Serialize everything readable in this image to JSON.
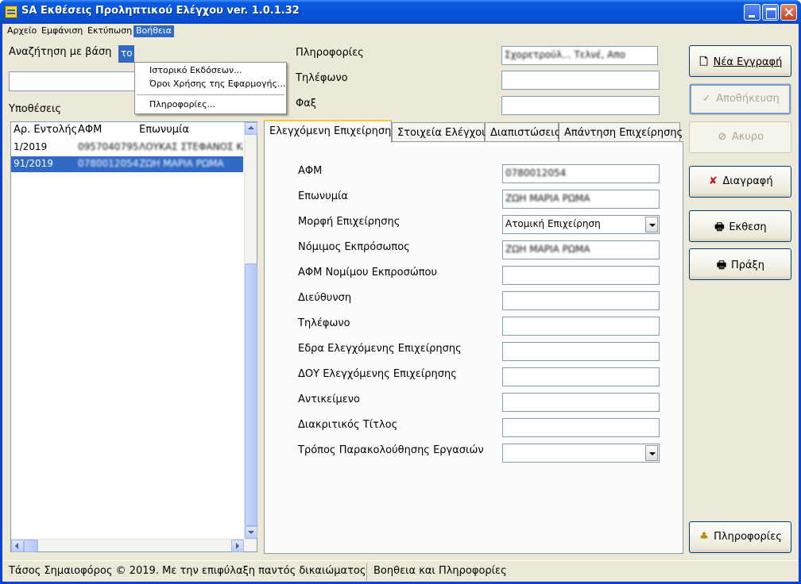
{
  "window": {
    "title": "SA Εκθέσεις Προληπτικού Ελέγχου ver. 1.0.1.32"
  },
  "menubar": {
    "items": [
      "Αρχείο",
      "Εμφάνιση",
      "Εκτύπωση",
      "Βοήθεια"
    ],
    "active": "Βοήθεια"
  },
  "help_menu": {
    "items": [
      "Ιστορικό Εκδόσεων...",
      "Όροι Χρήσης της Εφαρμογής...",
      "Πληροφορίες..."
    ]
  },
  "search": {
    "label": "Αναζήτηση με βάση",
    "combo_value": "το",
    "input_value": ""
  },
  "cases": {
    "label": "Υποθέσεις",
    "columns": [
      "Αρ. Εντολής",
      "ΑΦΜ",
      "Επωνυμία"
    ],
    "rows": [
      {
        "order": "1/2019",
        "afm": "0957040795",
        "name": "ΛΟΥΚΑΣ ΣΤΕΦΑΝΟΣ ΚΑΙ"
      },
      {
        "order": "91/2019",
        "afm": "0780012054",
        "name": "ΖΩΗ ΜΑΡΙΑ ΡΩΜΑ"
      }
    ],
    "selected_index": 1
  },
  "info": {
    "label": "Πληροφορίες",
    "value": "Σχορετρούλ... Τελνέ, Απο",
    "phone_label": "Τηλέφωνο",
    "phone_value": "",
    "fax_label": "Φαξ",
    "fax_value": ""
  },
  "tabs": [
    {
      "label": "Ελεγχόμενη Επιχείρηση",
      "active": true
    },
    {
      "label": "Στοιχεία Ελέγχου",
      "active": false
    },
    {
      "label": "Διαπιστώσεις",
      "active": false
    },
    {
      "label": "Απάντηση Επιχείρησης",
      "active": false
    }
  ],
  "form": {
    "afm": {
      "label": "ΑΦΜ",
      "value": "0780012054"
    },
    "eponymia": {
      "label": "Επωνυμία",
      "value": "ΖΩΗ ΜΑΡΙΑ ΡΩΜΑ"
    },
    "morfi": {
      "label": "Μορφή Επιχείρησης",
      "value": "Ατομική Επιχείρηση"
    },
    "nomimos": {
      "label": "Νόμιμος Εκπρόσωπος",
      "value": "ΖΩΗ ΜΑΡΙΑ ΡΩΜΑ"
    },
    "afm_nomimou": {
      "label": "ΑΦΜ Νομίμου Εκπροσώπου",
      "value": ""
    },
    "dieythynsi": {
      "label": "Διεύθυνση",
      "value": ""
    },
    "tilefono": {
      "label": "Τηλέφωνο",
      "value": ""
    },
    "edra": {
      "label": "Εδρα Ελεγχόμενης Επιχείρησης",
      "value": ""
    },
    "doy": {
      "label": "ΔΟΥ Ελεγχόμενης Επιχείρησης",
      "value": ""
    },
    "antikeimeno": {
      "label": "Αντικείμενο",
      "value": ""
    },
    "diakritikos": {
      "label": "Διακριτικός Τίτλος",
      "value": ""
    },
    "tropos": {
      "label": "Τρόπος Παρακολούθησης Εργασιών",
      "value": ""
    }
  },
  "buttons": {
    "new": "Νέα Εγγραφή",
    "save": "Αποθήκευση",
    "cancel": "Ακυρο",
    "delete": "Διαγραφή",
    "report": "Εκθεση",
    "act": "Πράξη",
    "info": "Πληροφορίες"
  },
  "statusbar": {
    "copyright": "Τάσος Σημαιοφόρος © 2019. Με την επιφύλαξη παντός δικαιώματος",
    "help": "Βοηθεια και Πληροφορίες"
  },
  "colors": {
    "titlebar": "#0854d6",
    "selection": "#316ac5",
    "delete_icon": "#c0141c"
  }
}
